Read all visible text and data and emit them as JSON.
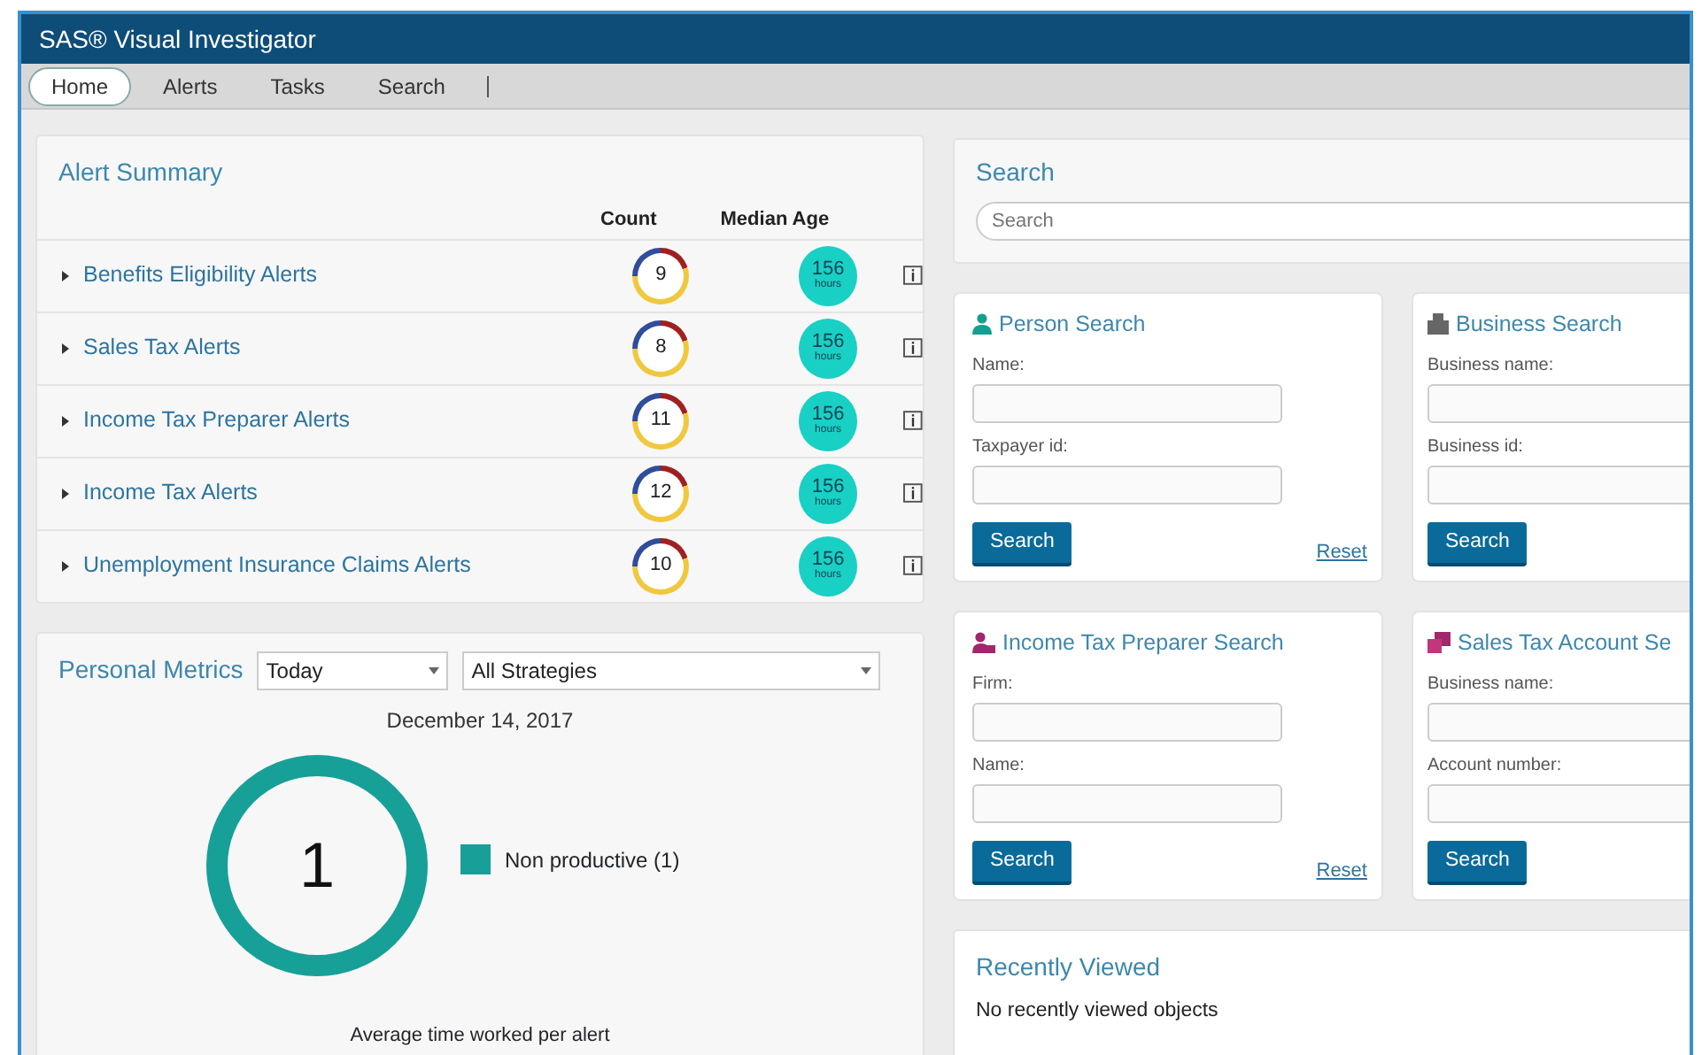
{
  "window": {
    "title": "SAS® Visual Investigator"
  },
  "tabs": [
    {
      "label": "Home",
      "selected": true
    },
    {
      "label": "Alerts",
      "selected": false
    },
    {
      "label": "Tasks",
      "selected": false
    },
    {
      "label": "Search",
      "selected": false
    }
  ],
  "alert_summary": {
    "title": "Alert Summary",
    "columns": [
      "Count",
      "Median Age"
    ],
    "rows": [
      {
        "name": "Benefits Eligibility Alerts",
        "count": "9",
        "age": "156",
        "age_unit": "hours"
      },
      {
        "name": "Sales Tax Alerts",
        "count": "8",
        "age": "156",
        "age_unit": "hours"
      },
      {
        "name": "Income Tax Preparer Alerts",
        "count": "11",
        "age": "156",
        "age_unit": "hours"
      },
      {
        "name": "Income Tax Alerts",
        "count": "12",
        "age": "156",
        "age_unit": "hours"
      },
      {
        "name": "Unemployment Insurance Claims Alerts",
        "count": "10",
        "age": "156",
        "age_unit": "hours"
      }
    ]
  },
  "personal_metrics": {
    "title": "Personal Metrics",
    "period": "Today",
    "strategy": "All Strategies",
    "date": "December 14, 2017",
    "center": "1",
    "legend": [
      {
        "label": "Non productive (1)",
        "color": "#17a097"
      }
    ],
    "caption": "Average time worked per alert"
  },
  "search": {
    "title": "Search",
    "placeholder": "Search"
  },
  "search_forms": [
    {
      "title": "Person Search",
      "kind": "person",
      "fields": [
        "Name:",
        "Taxpayer id:"
      ],
      "button": "Search",
      "reset": "Reset"
    },
    {
      "title": "Business Search",
      "kind": "business",
      "fields": [
        "Business name:",
        "Business id:"
      ],
      "button": "Search"
    },
    {
      "title": "Income Tax Preparer Search",
      "kind": "preparer",
      "fields": [
        "Firm:",
        "Name:"
      ],
      "button": "Search",
      "reset": "Reset"
    },
    {
      "title": "Sales Tax Account Se",
      "kind": "account",
      "fields": [
        "Business name:",
        "Account number:"
      ],
      "button": "Search"
    }
  ],
  "recently_viewed": {
    "title": "Recently Viewed",
    "message": "No recently viewed objects"
  }
}
